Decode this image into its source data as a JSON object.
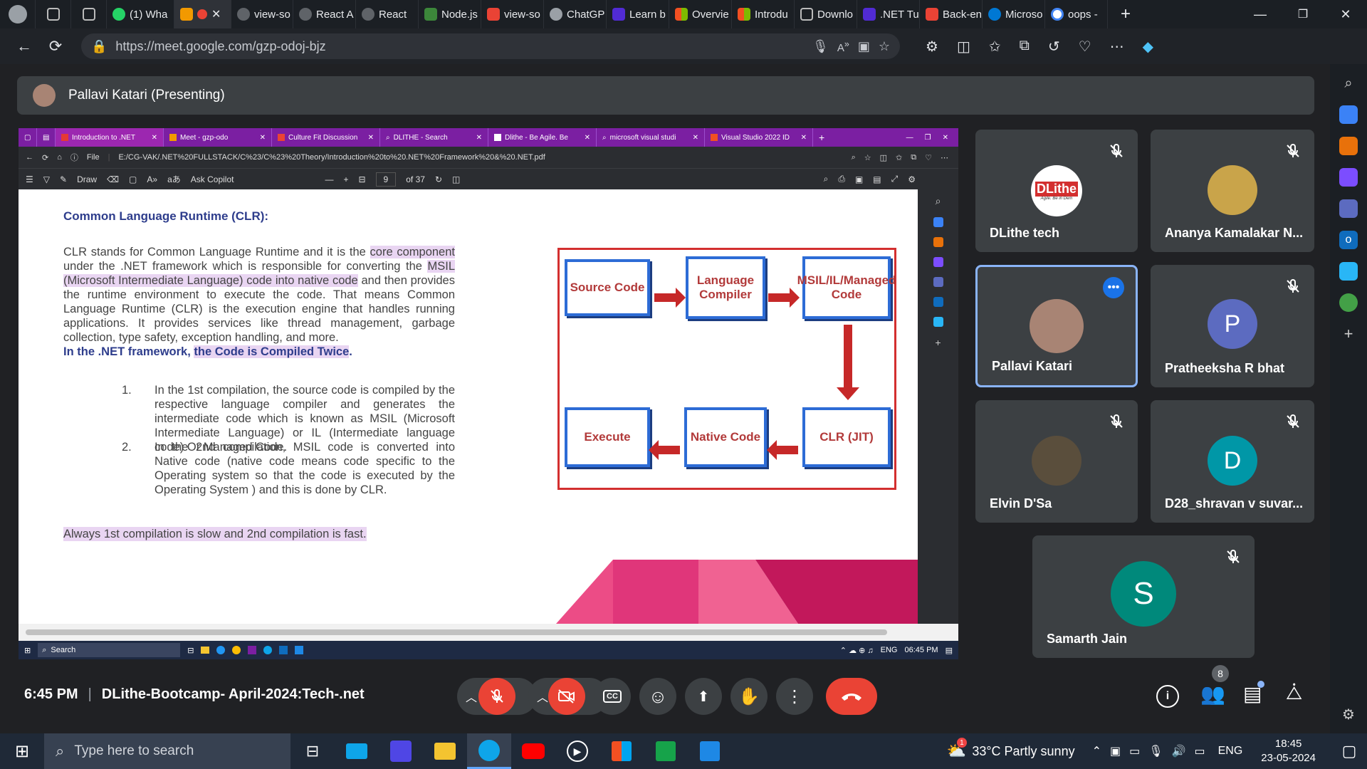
{
  "browser": {
    "tabs": [
      {
        "label": "",
        "color": "#9aa0a6"
      },
      {
        "label": "",
        "color": "#9aa0a6"
      },
      {
        "label": "",
        "color": "#9aa0a6"
      },
      {
        "label": "(1) Wha",
        "color": "#25d366"
      },
      {
        "label": "",
        "color": "#f29900"
      },
      {
        "label": "",
        "color": "#ea4335"
      },
      {
        "label": "view-so",
        "color": "#5f6368"
      },
      {
        "label": "React A",
        "color": "#5f6368"
      },
      {
        "label": "React",
        "color": "#5f6368"
      },
      {
        "label": "Node.js",
        "color": "#3c873a"
      },
      {
        "label": "view-so",
        "color": "#ea4335"
      },
      {
        "label": "ChatGP",
        "color": "#9aa0a6"
      },
      {
        "label": "Learn b",
        "color": "#512bd4"
      },
      {
        "label": "Overvie",
        "color": "#f25022"
      },
      {
        "label": "Introdu",
        "color": "#f25022"
      },
      {
        "label": "Downlo",
        "color": "#9aa0a6"
      },
      {
        "label": ".NET Tu",
        "color": "#512bd4"
      },
      {
        "label": "Back-en",
        "color": "#ea4335"
      },
      {
        "label": "Microso",
        "color": "#0078d4"
      },
      {
        "label": "oops -",
        "color": "#4285f4"
      }
    ],
    "url": "https://meet.google.com/gzp-odoj-bjz"
  },
  "meet": {
    "presenter_label": "Pallavi Katari (Presenting)",
    "time": "6:45 PM",
    "meeting_name": "DLithe-Bootcamp- April-2024:Tech-.net",
    "participant_count": "8"
  },
  "shared": {
    "tabs": [
      "Introduction to .NET",
      "Meet - gzp-odo",
      "Culture Fit Discussion",
      "DLITHE - Search",
      "Dlithe - Be Agile. Be",
      "microsoft visual studi",
      "Visual Studio 2022 ID"
    ],
    "file_label": "File",
    "path": "E:/CG-VAK/.NET%20FULLSTACK/C%23/C%23%20Theory/Introduction%20to%20.NET%20Framework%20&%20.NET.pdf",
    "draw_label": "Draw",
    "ask_copilot": "Ask Copilot",
    "page_num": "9",
    "page_total": "of 37",
    "taskbar_search": "Search",
    "taskbar_lang": "ENG",
    "taskbar_time": "06:45 PM"
  },
  "doc": {
    "heading": "Common Language Runtime (CLR):",
    "para_before": "CLR stands for Common Language Runtime and it is the",
    "para_hl1": "core component",
    "para_mid": "under the .NET framework which is responsible for converting the",
    "para_hl2": "MSIL (Microsoft Intermediate Language) code into native code",
    "para_after": "and then provides the runtime environment to execute the code. That means Common Language Runtime (CLR) is the execution engine that handles running applications. It provides services like thread management, garbage collection, type safety, exception handling, and more.",
    "compiled_pre": "In the .NET framework,",
    "compiled_hl": "the Code is Compiled Twice",
    "compiled_post": ".",
    "item1_num": "1.",
    "item1": "In the 1st compilation, the source code is compiled by the respective language compiler and generates the intermediate code which is known as MSIL (Microsoft Intermediate Language) or IL (Intermediate language code) Or Managed Code.",
    "item2_num": "2.",
    "item2": "In the 2nd compilation, MSIL code is converted into Native code (native code means code specific to the Operating system so that the code is executed by the Operating System ) and this is done by CLR.",
    "footer": "Always 1st compilation is slow and 2nd compilation is fast.",
    "diagram": {
      "source": "Source Code",
      "compiler": "Language Compiler",
      "msil": "MSIL/IL/Managed Code",
      "clr": "CLR (JIT)",
      "native": "Native Code",
      "execute": "Execute"
    }
  },
  "participants": [
    {
      "name": "DLithe tech",
      "logo_text": "DLithe",
      "logo_sub": "Agile. Be in Dem"
    },
    {
      "name": "Ananya Kamalakar N...",
      "color": "#c9a44a"
    },
    {
      "name": "Pallavi Katari",
      "color": "#a88474"
    },
    {
      "name": "Pratheeksha R bhat",
      "initial": "P",
      "color": "#5c6bc0"
    },
    {
      "name": "Elvin D'Sa",
      "color": "#5a4e3c"
    },
    {
      "name": "D28_shravan v suvar...",
      "initial": "D",
      "color": "#0097a7"
    },
    {
      "name": "Samarth Jain",
      "initial": "S",
      "color": "#00897b"
    }
  ],
  "taskbar": {
    "search_placeholder": "Type here to search",
    "weather": "33°C  Partly sunny",
    "weather_badge": "1",
    "lang": "ENG",
    "time": "18:45",
    "date": "23-05-2024"
  },
  "colors": {
    "meet_bg": "#202124",
    "tile_bg": "#3c4043",
    "active_border": "#8ab4f8",
    "end_call": "#ea4335",
    "mic_off": "#ea4335"
  }
}
